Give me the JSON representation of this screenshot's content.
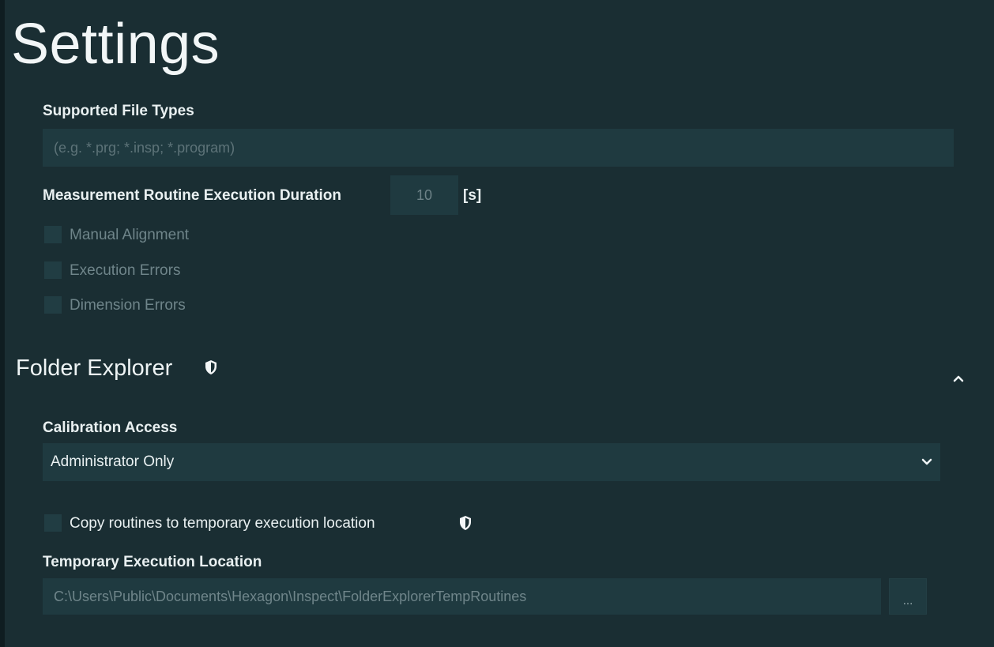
{
  "page": {
    "title": "Settings"
  },
  "file_types": {
    "label": "Supported File Types",
    "placeholder": "(e.g. *.prg; *.insp; *.program)",
    "value": ""
  },
  "duration": {
    "label": "Measurement Routine Execution Duration",
    "value": "10",
    "unit": "[s]"
  },
  "checks": {
    "manual_alignment": "Manual Alignment",
    "execution_errors": "Execution Errors",
    "dimension_errors": "Dimension Errors"
  },
  "folder_explorer": {
    "title": "Folder Explorer",
    "calibration_label": "Calibration Access",
    "calibration_value": "Administrator Only",
    "copy_label": "Copy routines to temporary execution location",
    "temp_label": "Temporary Execution Location",
    "temp_value": "C:\\Users\\Public\\Documents\\Hexagon\\Inspect\\FolderExplorerTempRoutines",
    "browse_label": "..."
  },
  "colors": {
    "background": "#1b2f34",
    "input": "#1f3a40",
    "text": "#e9f0f1",
    "muted": "#6f858a"
  },
  "icons": {
    "admin": "shield-icon",
    "collapse": "chevron-up-icon",
    "dropdown": "chevron-down-icon"
  }
}
